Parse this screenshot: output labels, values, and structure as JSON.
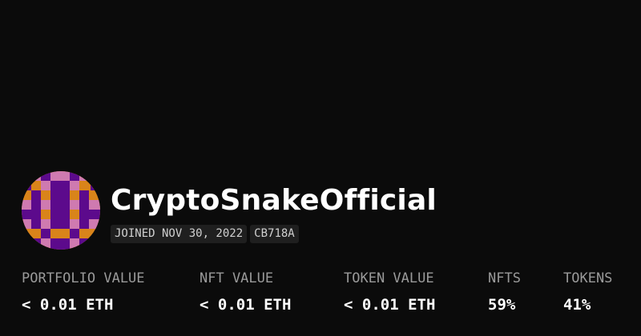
{
  "profile": {
    "username": "CryptoSnakeOfficial",
    "joined": "JOINED NOV 30, 2022",
    "id_tag": "CB718A",
    "avatar": {
      "icon": "pixel-identicon-avatar",
      "colors": {
        "orange": "#d9841a",
        "purple": "#5c0a8c",
        "pink": "#cf7ab0"
      }
    }
  },
  "stats": [
    {
      "label": "PORTFOLIO VALUE",
      "value": "< 0.01 ETH"
    },
    {
      "label": "NFT VALUE",
      "value": "< 0.01 ETH"
    },
    {
      "label": "TOKEN VALUE",
      "value": "< 0.01 ETH"
    },
    {
      "label": "NFTS",
      "value": "59%"
    },
    {
      "label": "TOKENS",
      "value": "41%"
    }
  ],
  "colors": {
    "background": "#0b0b0b",
    "label": "#9a9a9a",
    "value": "#ffffff",
    "tag_background": "#1f1f1f"
  }
}
